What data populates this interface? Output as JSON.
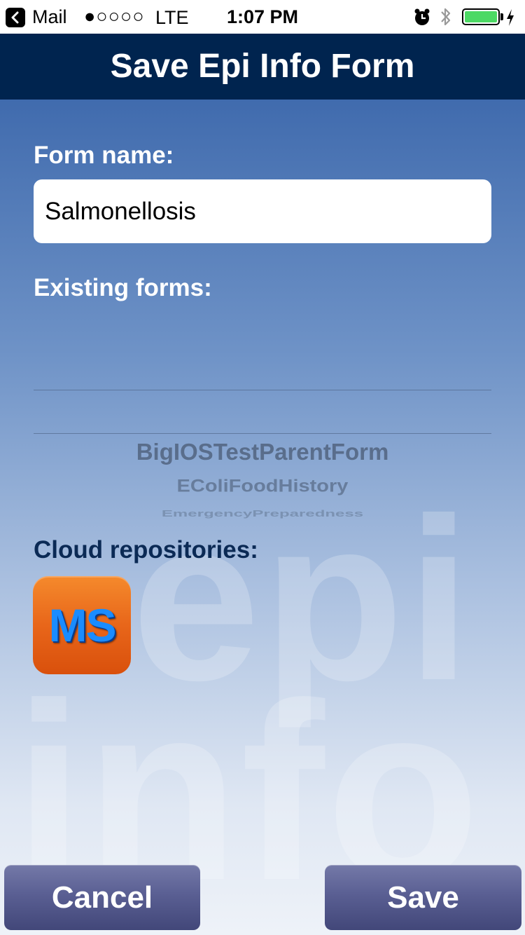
{
  "status_bar": {
    "back_app": "Mail",
    "signal": "●○○○○",
    "network": "LTE",
    "time": "1:07 PM",
    "battery_color": "#4cd964"
  },
  "header": {
    "title": "Save Epi Info Form",
    "background": "#00244f"
  },
  "watermark": {
    "line1": "epi",
    "line2": "info"
  },
  "form_name": {
    "label": "Form name:",
    "value": "Salmonellosis"
  },
  "existing_forms": {
    "label": "Existing forms:",
    "items": [
      "BigIOSTestParentForm",
      "EColiFoodHistory",
      "EmergencyPreparedness"
    ]
  },
  "cloud": {
    "label": "Cloud repositories:",
    "ms_label": "MS",
    "ms_icon": "microsoft-cloud-icon"
  },
  "buttons": {
    "cancel": "Cancel",
    "save": "Save"
  }
}
